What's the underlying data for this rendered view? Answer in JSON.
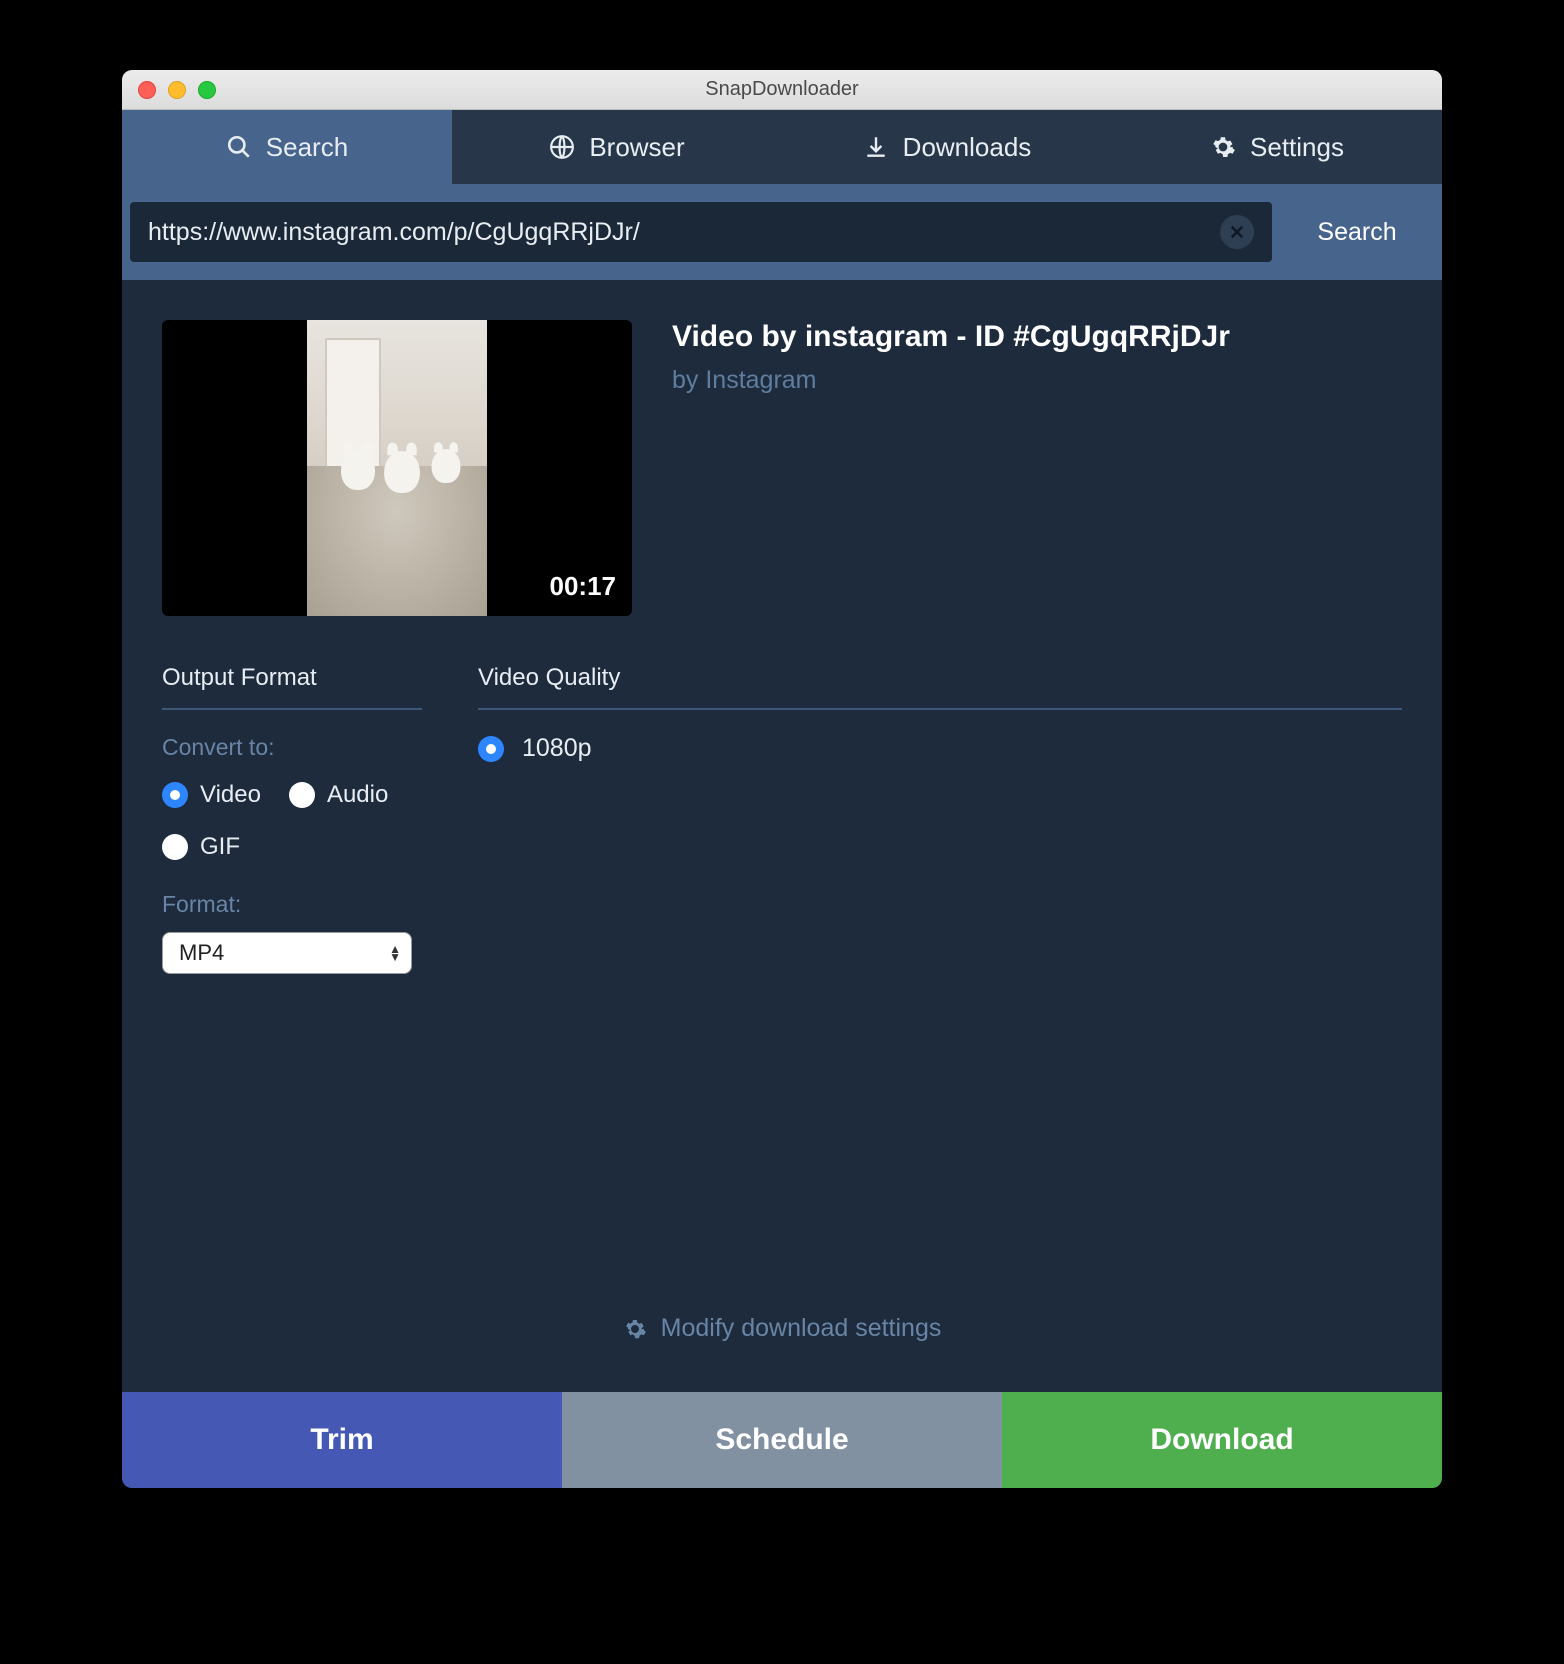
{
  "window": {
    "title": "SnapDownloader"
  },
  "tabs": {
    "search": "Search",
    "browser": "Browser",
    "downloads": "Downloads",
    "settings": "Settings",
    "active": "search"
  },
  "searchbar": {
    "url_value": "https://www.instagram.com/p/CgUgqRRjDJr/",
    "search_label": "Search"
  },
  "video": {
    "title": "Video by instagram - ID #CgUgqRRjDJr",
    "byline": "by Instagram",
    "duration": "00:17"
  },
  "output_format": {
    "section_title": "Output Format",
    "convert_label": "Convert to:",
    "options": {
      "video": "Video",
      "audio": "Audio",
      "gif": "GIF"
    },
    "selected_type": "video",
    "format_label": "Format:",
    "format_value": "MP4"
  },
  "video_quality": {
    "section_title": "Video Quality",
    "options": [
      "1080p"
    ],
    "selected": "1080p"
  },
  "modify_settings_label": "Modify download settings",
  "actions": {
    "trim": "Trim",
    "schedule": "Schedule",
    "download": "Download"
  }
}
